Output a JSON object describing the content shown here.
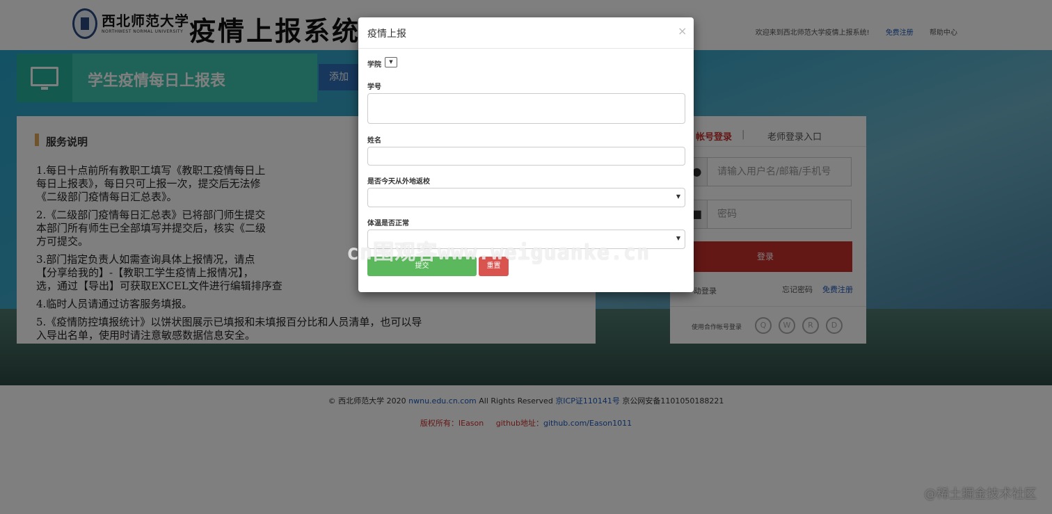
{
  "header": {
    "school_name": "西北师范大学",
    "school_en": "NORTHWEST NORMAL UNIVERSITY",
    "system_name": "疫情上报系统",
    "welcome": "欢迎来到西北师范大学疫情上报系统!",
    "register": "免费注册",
    "help": "帮助中心"
  },
  "banner": {
    "icon": "monitor-icon",
    "title": "学生疫情每日上报表",
    "add_button": "添加"
  },
  "service": {
    "title": "服务说明",
    "items": [
      "1.每日十点前所有教职工填写《教职工疫情每日上",
      "每日上报表》，每日只可上报一次，提交后无法修",
      "《二级部门疫情每日汇总表》。",
      "2.《二级部门疫情每日汇总表》已将部门师生提交",
      "本部门所有师生已全部填写并提交后，核实《二级",
      "方可提交。",
      "3.部门指定负责人如需查询具体上报情况，请点",
      "【分享给我的】-【教职工学生疫情上报情况】，",
      "选，通过【导出】可获取EXCEL文件进行编辑排序查",
      "4.临时人员请通过访客服务填报。",
      "5.《疫情防控填报统计》以饼状图展示已填报和未填报百分比和人员清单，也可以导",
      "入导出名单，使用时请注意敏感数据信息安全。"
    ]
  },
  "login": {
    "tab_account": "帐号登录",
    "separator": "|",
    "tab_teacher": "老师登录入口",
    "username_placeholder": "请输入用户名/邮箱/手机号",
    "password_placeholder": "密码",
    "login_button": "登录",
    "auto_login": "动登录",
    "forgot": "忘记密码",
    "register": "免费注册",
    "partner": "使用合作帐号登录"
  },
  "footer": {
    "copy_prefix": "© 西北师范大学 2020",
    "domain": "nwnu.edu.cn.com",
    "rights": "All Rights Reserved",
    "icp": "京ICP证110141号",
    "police": "京公网安备1101050188221",
    "author_label": "版权所有：IEason",
    "github_label": "github地址：",
    "github_url": "github.com/Eason1011"
  },
  "corner_mark": "@稀土掘金技术社区",
  "watermark": "cn围观客www.weiguanke.cn",
  "modal": {
    "title": "疫情上报",
    "close": "×",
    "college_label": "学院",
    "college_arrow": "▼",
    "student_id_label": "学号",
    "name_label": "姓名",
    "return_label": "是否今天从外地返校",
    "temperature_label": "体温是否正常",
    "submit": "提交",
    "reset": "重置"
  }
}
